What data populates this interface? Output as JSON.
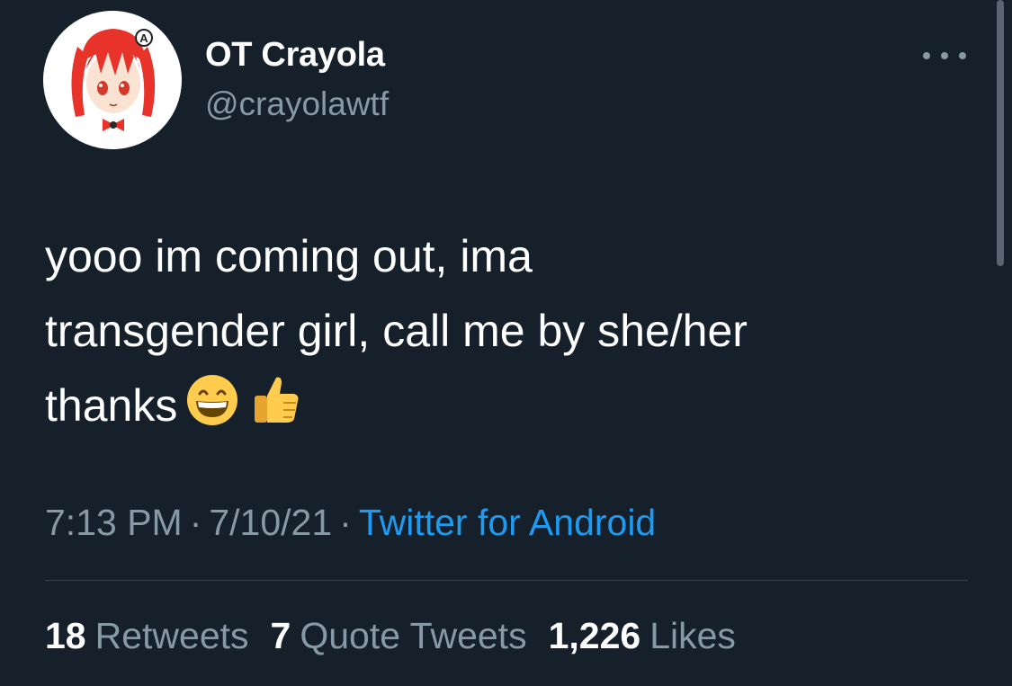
{
  "author": {
    "display_name": "OT Crayola",
    "handle": "@crayolawtf",
    "avatar_icon": "anime-girl-avatar-icon"
  },
  "tweet": {
    "text_lines": [
      "yooo im coming out, ima",
      "transgender girl, call me by she/her",
      "thanks"
    ],
    "emojis": [
      "grinning-face-emoji",
      "thumbs-up-emoji"
    ]
  },
  "meta": {
    "time": "7:13 PM",
    "separator": "·",
    "date": "7/10/21",
    "source": "Twitter for Android"
  },
  "stats": {
    "retweets_count": "18",
    "retweets_label": "Retweets",
    "quotes_count": "7",
    "quotes_label": "Quote Tweets",
    "likes_count": "1,226",
    "likes_label": "Likes"
  },
  "colors": {
    "background": "#15202b",
    "secondary_text": "#8899a6",
    "link": "#1d9bf0",
    "divider": "#38444d"
  }
}
